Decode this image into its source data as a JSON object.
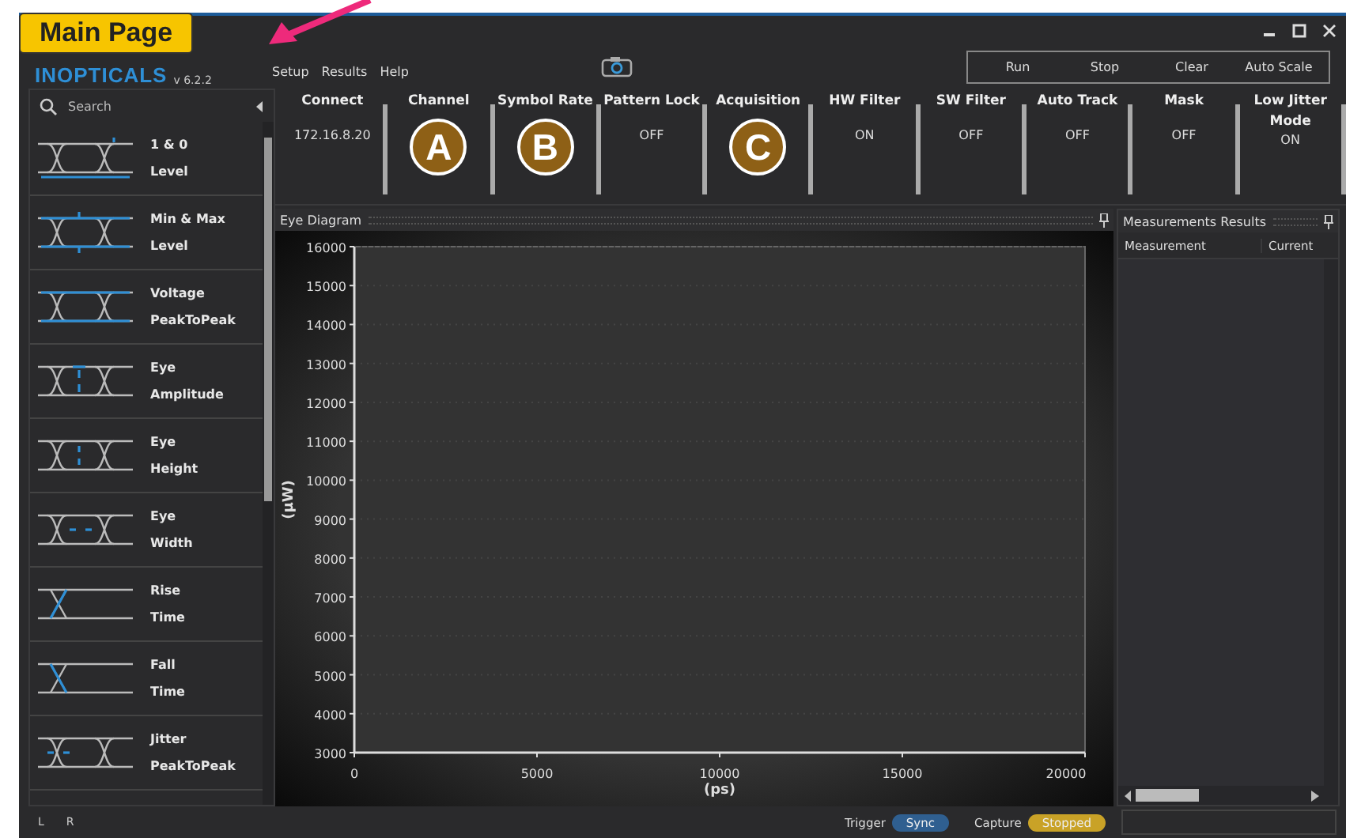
{
  "callout": {
    "label": "Main Page"
  },
  "logo": {
    "name": "INOPTICALS",
    "version": "v 6.2.2"
  },
  "menu": [
    "Setup",
    "Results",
    "Help"
  ],
  "actions": [
    "Run",
    "Stop",
    "Clear",
    "Auto Scale"
  ],
  "sidebar": {
    "search_placeholder": "Search",
    "items": [
      {
        "kind": "level",
        "line1": "1 & 0",
        "line2": "Level"
      },
      {
        "kind": "minmax",
        "line1": "Min & Max",
        "line2": "Level"
      },
      {
        "kind": "vpp",
        "line1": "Voltage",
        "line2": "PeakToPeak"
      },
      {
        "kind": "amplitude",
        "line1": "Eye",
        "line2": "Amplitude"
      },
      {
        "kind": "height",
        "line1": "Eye",
        "line2": "Height"
      },
      {
        "kind": "width",
        "line1": "Eye",
        "line2": "Width"
      },
      {
        "kind": "rise",
        "line1": "Rise",
        "line2": "Time"
      },
      {
        "kind": "fall",
        "line1": "Fall",
        "line2": "Time"
      },
      {
        "kind": "jitter",
        "line1": "Jitter",
        "line2": "PeakToPeak"
      }
    ]
  },
  "toolbar": [
    {
      "label": "Connect",
      "value": "172.16.8.20"
    },
    {
      "label": "Channel",
      "marker": "A"
    },
    {
      "label": "Symbol Rate",
      "marker": "B"
    },
    {
      "label": "Pattern Lock",
      "value": "OFF"
    },
    {
      "label": "Acquisition",
      "marker": "C"
    },
    {
      "label": "HW Filter",
      "value": "ON"
    },
    {
      "label": "SW Filter",
      "value": "OFF"
    },
    {
      "label": "Auto Track",
      "value": "OFF"
    },
    {
      "label": "Mask",
      "value": "OFF"
    },
    {
      "label": "Low Jitter Mode",
      "value": "ON"
    }
  ],
  "eye_diagram": {
    "title": "Eye Diagram",
    "chart_data": {
      "type": "line",
      "grid": true,
      "xlabel": "(ps)",
      "ylabel": "(µW)",
      "xlim": [
        0,
        20000
      ],
      "ylim": [
        3000,
        16000
      ],
      "xticks": [
        0,
        5000,
        10000,
        15000,
        20000
      ],
      "yticks": [
        3000,
        4000,
        5000,
        6000,
        7000,
        8000,
        9000,
        10000,
        11000,
        12000,
        13000,
        14000,
        15000,
        16000
      ]
    }
  },
  "measurements": {
    "title": "Measurements Results",
    "columns": [
      "Measurement",
      "Current"
    ]
  },
  "status_bar": {
    "channels": [
      "L",
      "R"
    ],
    "indicators": [
      {
        "label": "Trigger",
        "value": "Sync",
        "color": "#2f5f90"
      },
      {
        "label": "Capture",
        "value": "Stopped",
        "color": "#c9a227"
      }
    ]
  }
}
